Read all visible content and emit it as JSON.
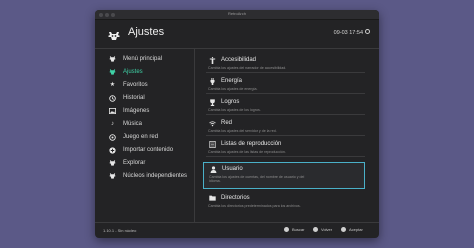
{
  "window": {
    "title": "RetroArch"
  },
  "header": {
    "title": "Ajustes",
    "clock": "09-03 17:54"
  },
  "sidebar": {
    "items": [
      {
        "label": "Menú principal",
        "icon": "retroarch-logo-icon"
      },
      {
        "label": "Ajustes",
        "icon": "settings-icon",
        "active": true
      },
      {
        "label": "Favoritos",
        "icon": "star-icon"
      },
      {
        "label": "Historial",
        "icon": "history-icon"
      },
      {
        "label": "Imágenes",
        "icon": "image-icon"
      },
      {
        "label": "Música",
        "icon": "music-icon"
      },
      {
        "label": "Juego en red",
        "icon": "netplay-icon"
      },
      {
        "label": "Importar contenido",
        "icon": "add-icon"
      },
      {
        "label": "Explorar",
        "icon": "gamepad-icon"
      },
      {
        "label": "Núcleos independientes",
        "icon": "gamepad-icon"
      }
    ]
  },
  "content": {
    "items": [
      {
        "label": "Accesibilidad",
        "desc": "Cambia los ajustes del narrador de accesibilidad."
      },
      {
        "label": "Energía",
        "desc": "Cambia los ajustes de energía."
      },
      {
        "label": "Logros",
        "desc": "Cambia los ajustes de los logros."
      },
      {
        "label": "Red",
        "desc": "Cambia los ajustes del servidor y de la red."
      },
      {
        "label": "Listas de reproducción",
        "desc": "Cambia los ajustes de las listas de reproducción."
      },
      {
        "label": "Usuario",
        "desc": "Cambia los ajustes de cuentas, del nombre de usuario y del idioma.",
        "selected": true
      },
      {
        "label": "Directorios",
        "desc": "Cambia los directorios predeterminados para los archivos."
      }
    ]
  },
  "footer": {
    "version": "1.10.1 - Sin núcleo",
    "search": "Buscar",
    "back": "Volver",
    "accept": "Aceptar"
  },
  "colors": {
    "accent": "#3fd1a6",
    "selection_border": "#4ab0c8",
    "background": "#5b5987"
  }
}
